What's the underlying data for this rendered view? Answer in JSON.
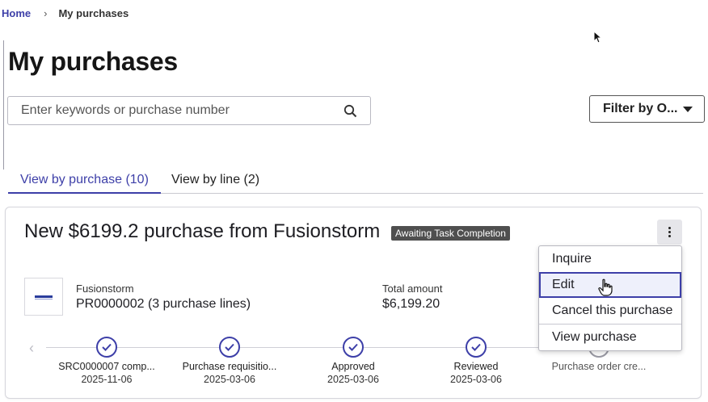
{
  "breadcrumb": {
    "home": "Home",
    "separator": "›",
    "current": "My purchases"
  },
  "page": {
    "title": "My purchases"
  },
  "search": {
    "placeholder": "Enter keywords or purchase number",
    "icon": "search-icon"
  },
  "filter": {
    "label": "Filter by O...",
    "icon": "caret-down-icon"
  },
  "tabs": [
    {
      "label": "View by purchase (10)",
      "active": true
    },
    {
      "label": "View by line (2)",
      "active": false
    }
  ],
  "card": {
    "title": "New $6199.2 purchase from Fusionstorm",
    "status": "Awaiting Task Completion",
    "supplier": "Fusionstorm",
    "requisition": "PR0000002 (3 purchase lines)",
    "total_label": "Total amount",
    "total_value": "$6,199.20",
    "steps": [
      {
        "label": "SRC0000007 comp...",
        "date": "2025-11-06",
        "complete": true
      },
      {
        "label": "Purchase requisitio...",
        "date": "2025-03-06",
        "complete": true
      },
      {
        "label": "Approved",
        "date": "2025-03-06",
        "complete": true
      },
      {
        "label": "Reviewed",
        "date": "2025-03-06",
        "complete": true
      },
      {
        "label": "Purchase order cre...",
        "date": "",
        "complete": false
      }
    ]
  },
  "menu": {
    "items": [
      {
        "label": "Inquire"
      },
      {
        "label": "Edit",
        "selected": true
      },
      {
        "label": "Cancel this purchase"
      },
      {
        "label": "View purchase"
      }
    ]
  },
  "colors": {
    "accent": "#3d3fa8",
    "badge_bg": "#4f4f4f"
  }
}
